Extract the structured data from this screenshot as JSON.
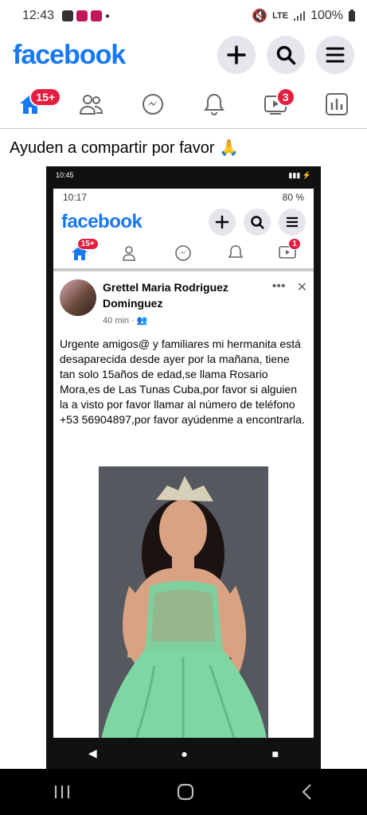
{
  "status": {
    "time": "12:43",
    "network": "LTE",
    "battery": "100%"
  },
  "header": {
    "logo": "facebook"
  },
  "nav": {
    "home_badge": "15+",
    "video_badge": "3"
  },
  "caption": "Ayuden a compartir por favor 🙏",
  "screenshot": {
    "outer_time": "10:45",
    "status_time": "10:17",
    "battery": "80 %",
    "logo": "facebook",
    "home_badge": "15+",
    "video_badge": "1",
    "post": {
      "author": "Grettel Maria Rodriguez Dominguez",
      "time": "40 min",
      "text": "Urgente amigos@ y familiares mi hermanita está desaparecida desde ayer por la mañana, tiene tan solo 15años de edad,se llama Rosario Mora,es de Las Tunas Cuba,por favor si alguien la a visto por favor llamar al número de teléfono +53 56904897,por favor ayúdenme a encontrarla."
    }
  },
  "colors": {
    "brand": "#1877f2",
    "badge": "#e41e3f"
  }
}
